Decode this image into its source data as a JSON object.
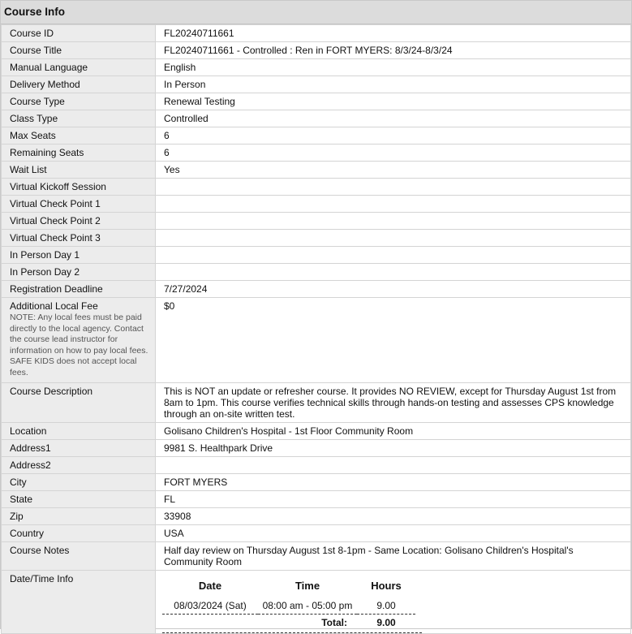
{
  "header": {
    "title": "Course Info"
  },
  "rows": [
    {
      "label": "Course ID",
      "value": "FL20240711661"
    },
    {
      "label": "Course Title",
      "value": "FL20240711661 - Controlled : Ren in FORT MYERS: 8/3/24-8/3/24"
    },
    {
      "label": "Manual Language",
      "value": "English"
    },
    {
      "label": "Delivery Method",
      "value": "In Person"
    },
    {
      "label": "Course Type",
      "value": "Renewal Testing"
    },
    {
      "label": "Class Type",
      "value": "Controlled"
    },
    {
      "label": "Max Seats",
      "value": "6"
    },
    {
      "label": "Remaining Seats",
      "value": "6"
    },
    {
      "label": "Wait List",
      "value": "Yes"
    },
    {
      "label": "Virtual Kickoff Session",
      "value": ""
    },
    {
      "label": "Virtual Check Point 1",
      "value": ""
    },
    {
      "label": "Virtual Check Point 2",
      "value": ""
    },
    {
      "label": "Virtual Check Point 3",
      "value": ""
    },
    {
      "label": "In Person Day 1",
      "value": ""
    },
    {
      "label": "In Person Day 2",
      "value": ""
    },
    {
      "label": "Registration Deadline",
      "value": "7/27/2024"
    },
    {
      "label": "Additional Local Fee",
      "value": "$0",
      "note": "NOTE: Any local fees must be paid directly to the local agency. Contact the course lead instructor for information on how to pay local fees. SAFE KIDS does not accept local fees."
    },
    {
      "label": "Course Description",
      "value": "This is NOT an update or refresher course. It provides NO REVIEW, except for Thursday August 1st from 8am to 1pm. This course verifies technical skills through hands-on testing and assesses CPS knowledge through an on-site written test."
    },
    {
      "label": "Location",
      "value": "Golisano Children's Hospital - 1st Floor Community Room"
    },
    {
      "label": "Address1",
      "value": "9981 S. Healthpark Drive"
    },
    {
      "label": "Address2",
      "value": ""
    },
    {
      "label": "City",
      "value": "FORT MYERS"
    },
    {
      "label": "State",
      "value": "FL"
    },
    {
      "label": "Zip",
      "value": "33908"
    },
    {
      "label": "Country",
      "value": "USA"
    },
    {
      "label": "Course Notes",
      "value": "Half day review on Thursday August 1st 8-1pm - Same Location: Golisano Children's Hospital's Community Room"
    }
  ],
  "datetime": {
    "label": "Date/Time Info",
    "headers": {
      "date": "Date",
      "time": "Time",
      "hours": "Hours"
    },
    "entries": [
      {
        "date": "08/03/2024 (Sat)",
        "time": "08:00 am - 05:00 pm",
        "hours": "9.00"
      }
    ],
    "total_label": "Total:",
    "total_value": "9.00"
  }
}
